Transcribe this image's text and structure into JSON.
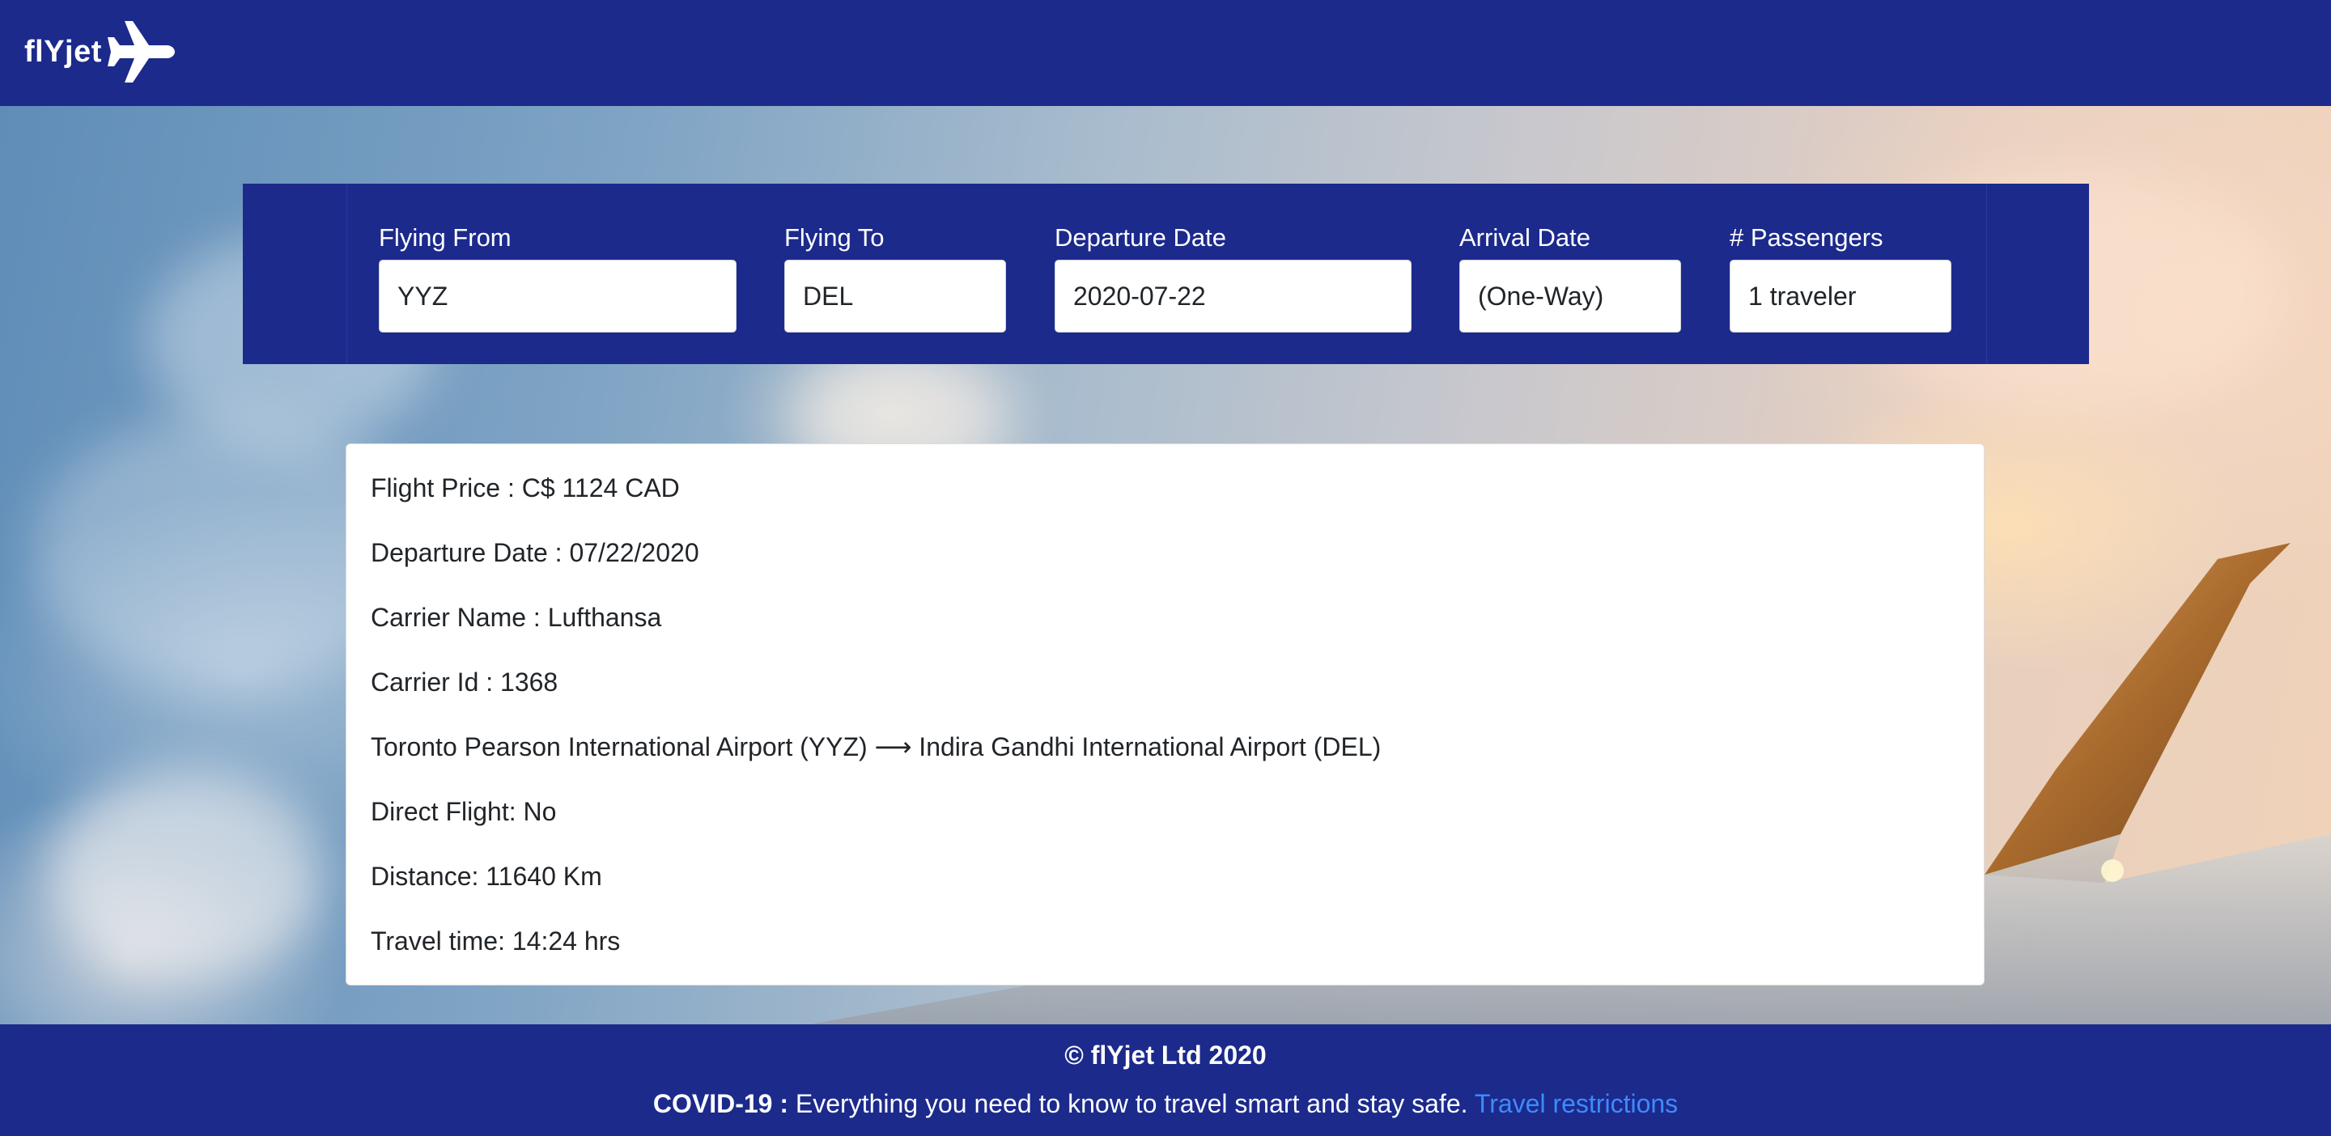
{
  "header": {
    "brand": "flYjet",
    "brand_icon": "airplane-icon"
  },
  "search": {
    "from_label": "Flying From",
    "from_value": "YYZ",
    "to_label": "Flying To",
    "to_value": "DEL",
    "departure_label": "Departure Date",
    "departure_value": "2020-07-22",
    "arrival_label": "Arrival Date",
    "arrival_value": "(One-Way)",
    "passengers_label": "# Passengers",
    "passengers_value": "1 traveler"
  },
  "result": {
    "lines": [
      "Flight Price : C$ 1124 CAD",
      "Departure Date : 07/22/2020",
      "Carrier Name : Lufthansa",
      "Carrier Id : 1368",
      "Toronto Pearson International Airport (YYZ) ⟶ Indira Gandhi International Airport (DEL)",
      "Direct Flight: No",
      "Distance: 11640 Km",
      "Travel time: 14:24 hrs"
    ]
  },
  "footer": {
    "copyright": "© flYjet Ltd 2020",
    "covid_label": "COVID-19 :",
    "covid_text": " Everything you need to know to travel smart and stay safe. ",
    "covid_link": "Travel restrictions"
  },
  "colors": {
    "navy": "#1c2a8c",
    "link": "#3d8bff",
    "white": "#ffffff"
  }
}
